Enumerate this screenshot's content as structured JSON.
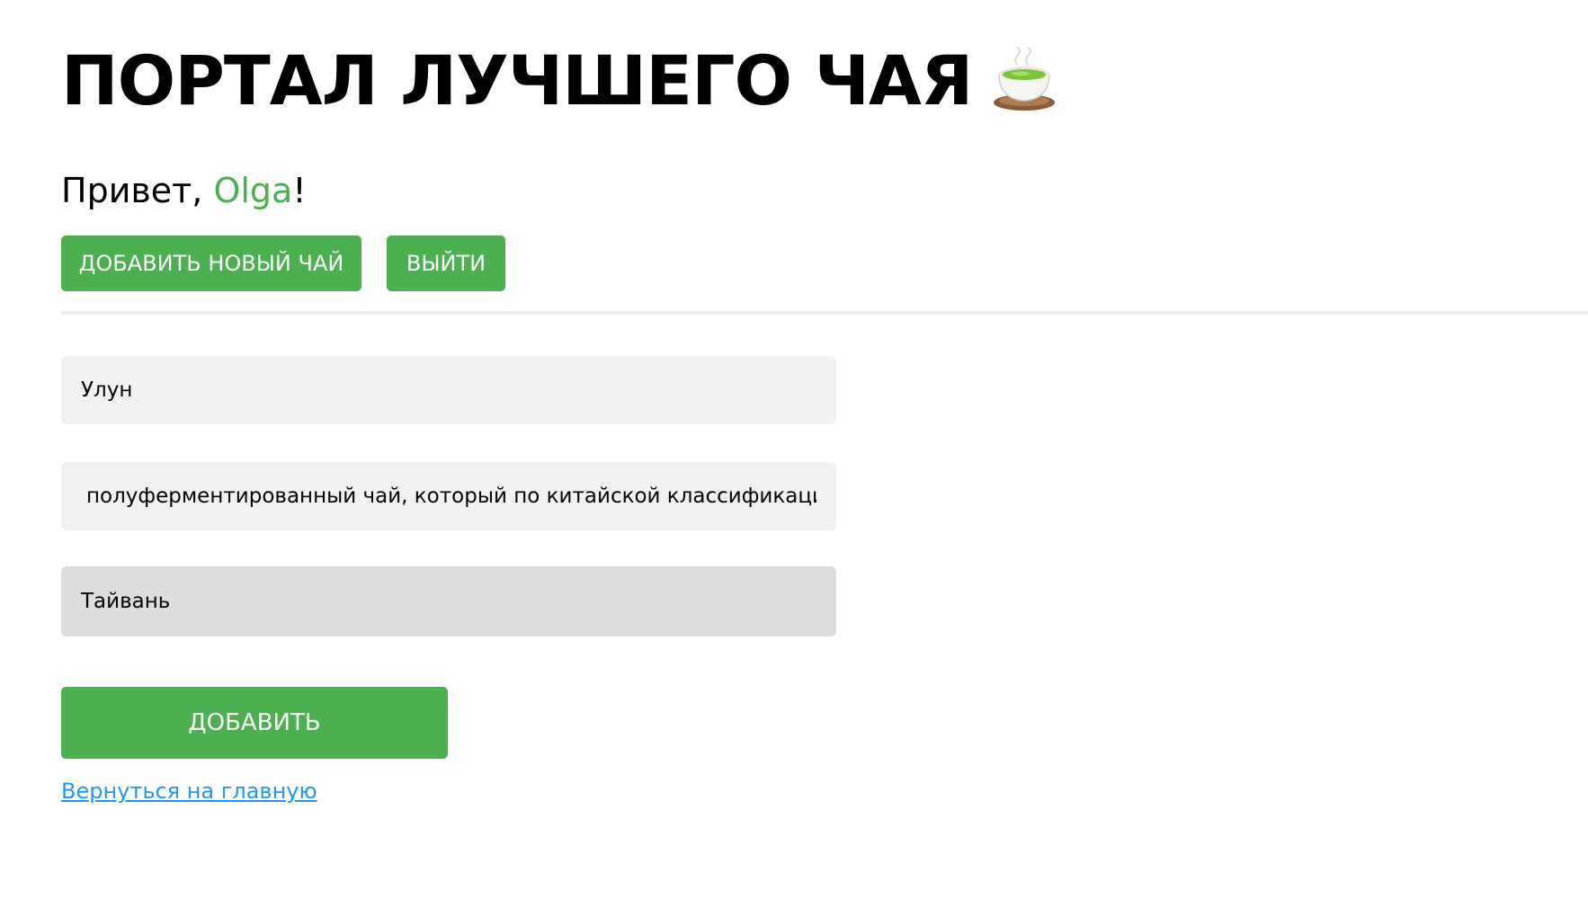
{
  "header": {
    "title": "ПОРТАЛ ЛУЧШЕГО ЧАЯ",
    "title_icon": "teacup-icon"
  },
  "greeting": {
    "prefix": "Привет, ",
    "username": "Olga",
    "suffix": "!"
  },
  "toolbar": {
    "add_tea_label": "ДОБАВИТЬ НОВЫЙ ЧАЙ",
    "logout_label": "ВЫЙТИ"
  },
  "form": {
    "name_value": "Улун",
    "description_value": "полуферментированный чай, который по китайской классификации занимает промежуточное положение между зелёным и красным чаем",
    "country_value": "Тайвань",
    "submit_label": "ДОБАВИТЬ"
  },
  "footer": {
    "back_link_label": "Вернуться на главную"
  },
  "colors": {
    "accent": "#4caf50",
    "link": "#2196f3",
    "field_bg": "#f1f1f1",
    "select_bg": "#dddddd"
  }
}
